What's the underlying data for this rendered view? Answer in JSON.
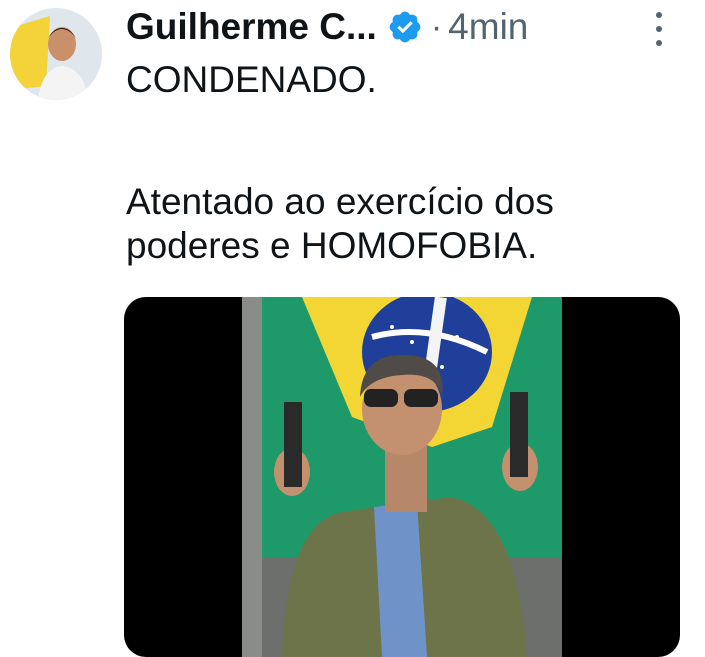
{
  "author": {
    "display_name": "Guilherme C...",
    "avatar": "avatar-image",
    "verified_icon": "verified-badge-icon"
  },
  "meta": {
    "separator": "·",
    "timestamp": "4min",
    "more_icon": "more-vertical-icon"
  },
  "tweet": {
    "line1": "CONDENADO.",
    "line2": "Atentado ao exercício dos poderes e HOMOFOBIA."
  },
  "media": {
    "type": "photo",
    "image": "man-with-flag-photo"
  },
  "colors": {
    "text": "#0f1419",
    "secondary": "#536471",
    "verified": "#1d9bf0",
    "media_bg": "#000000"
  }
}
